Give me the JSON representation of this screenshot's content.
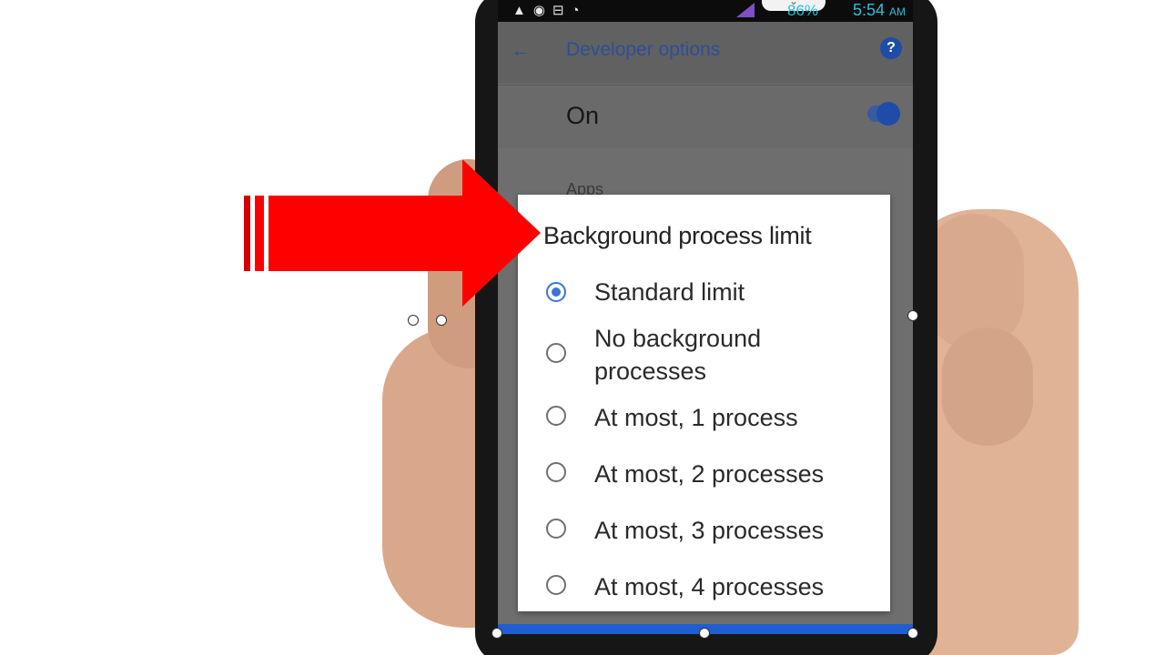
{
  "status_bar": {
    "battery": "86%",
    "time": "5:54",
    "am_pm": "AM"
  },
  "app_bar": {
    "title": "Developer options"
  },
  "master_switch": {
    "label": "On",
    "state": "on"
  },
  "section_hint": "Apps",
  "dialog": {
    "title": "Background process limit",
    "options": [
      {
        "label": "Standard limit",
        "selected": true
      },
      {
        "label": "No background processes",
        "selected": false
      },
      {
        "label": "At most, 1 process",
        "selected": false
      },
      {
        "label": "At most, 2 processes",
        "selected": false
      },
      {
        "label": "At most, 3 processes",
        "selected": false
      },
      {
        "label": "At most, 4 processes",
        "selected": false
      }
    ]
  },
  "colors": {
    "accent": "#3c74d8",
    "arrow": "#ff0000",
    "status_text": "#27c0d8",
    "toolbar_text": "#2d4f95"
  },
  "icons": [
    "back-arrow-icon",
    "help-icon",
    "warning-icon",
    "eye-icon",
    "cast-icon",
    "wifi-icon",
    "signal-icon",
    "battery-icon"
  ]
}
